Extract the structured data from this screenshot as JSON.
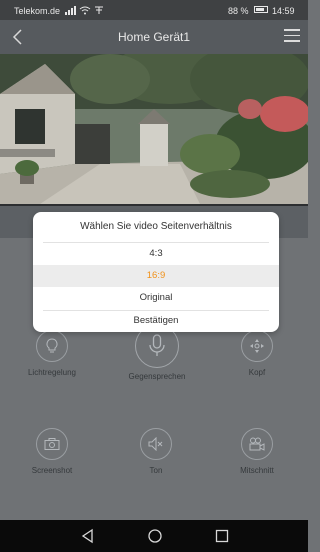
{
  "status_bar": {
    "carrier": "Telekom.de",
    "battery": "88 %",
    "time": "14:59"
  },
  "header": {
    "title": "Home Gerät1",
    "back_icon": "chevron-left-icon",
    "menu_icon": "hamburger-menu-icon"
  },
  "dialog": {
    "title": "Wählen Sie video Seitenverhältnis",
    "options": [
      {
        "label": "4:3",
        "selected": false
      },
      {
        "label": "16:9",
        "selected": true
      },
      {
        "label": "Original",
        "selected": false
      }
    ],
    "confirm_label": "Bestätigen",
    "accent_color": "#f1921b"
  },
  "controls": {
    "light": {
      "label": "Lichtregelung",
      "icon": "lightbulb-icon"
    },
    "talk": {
      "label": "Gegensprechen",
      "icon": "microphone-icon"
    },
    "head": {
      "label": "Kopf",
      "icon": "ptz-direction-icon"
    },
    "screenshot": {
      "label": "Screenshot",
      "icon": "camera-icon"
    },
    "sound": {
      "label": "Ton",
      "icon": "speaker-mute-icon"
    },
    "record": {
      "label": "Mitschnitt",
      "icon": "video-camera-icon"
    }
  },
  "nav_bar": {
    "back_icon": "triangle-back-icon",
    "home_icon": "circle-home-icon",
    "recent_icon": "square-recent-icon"
  }
}
